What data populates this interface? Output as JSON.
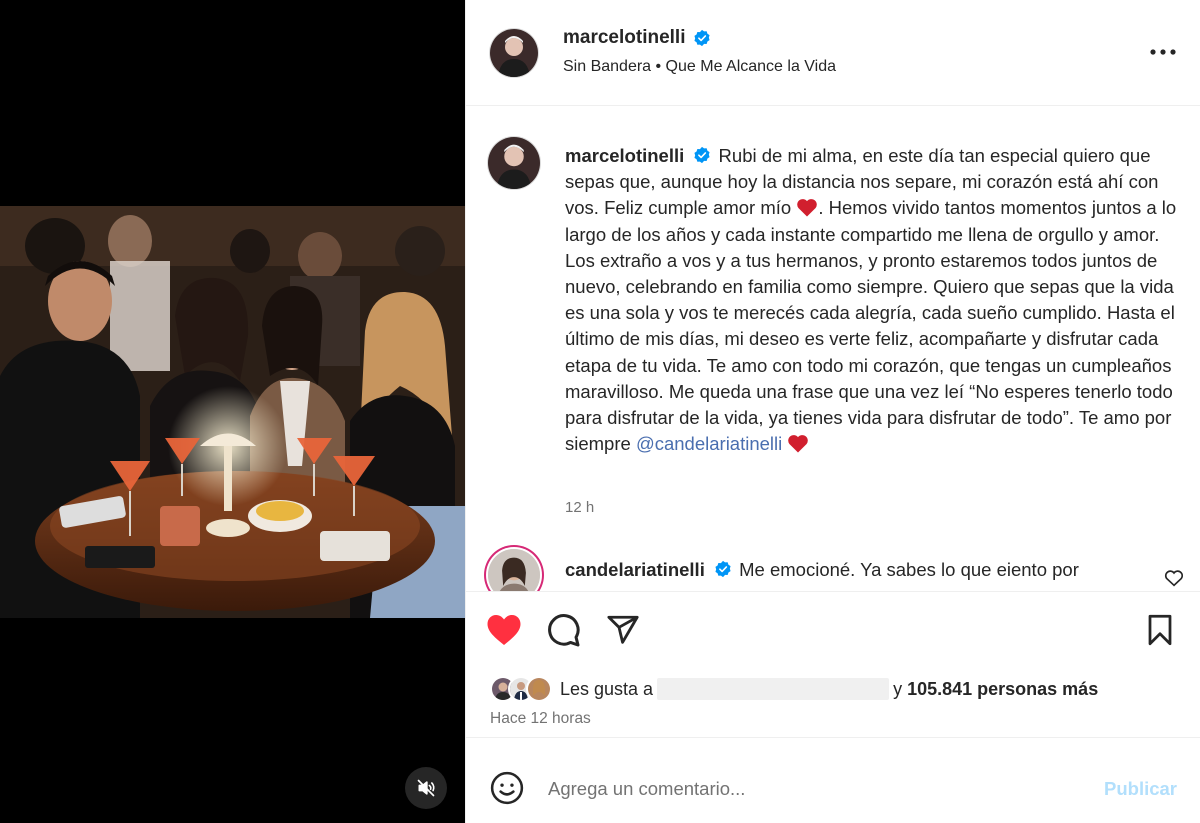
{
  "post": {
    "username": "marcelotinelli",
    "audio": "Sin Bandera • Que Me Alcance la Vida"
  },
  "caption": {
    "username": "marcelotinelli",
    "text_part1": "Rubi de mi alma, en este día tan especial quiero que sepas que, aunque hoy la distancia nos separe, mi corazón está ahí con vos. Feliz cumple amor mío ",
    "text_part2": ". Hemos vivido tantos momentos juntos a lo largo de los años y cada instante compartido me llena de orgullo y amor. Los extraño a vos y a tus hermanos, y pronto estaremos todos juntos de nuevo, celebrando en familia como siempre. Quiero que sepas que la vida es una sola y vos te merecés cada alegría, cada sueño cumplido. Hasta el último de mis días, mi deseo es verte feliz, acompañarte y disfrutar cada etapa de tu vida. Te amo con todo mi corazón, que tengas un cumpleaños maravilloso. Me queda una frase que una vez leí “No esperes tenerlo todo para disfrutar de la vida, ya tienes vida para disfrutar de todo”. Te amo por siempre ",
    "mention": "@candelariatinelli",
    "time": "12 h"
  },
  "reply": {
    "username": "candelariatinelli",
    "text": "Me emocioné. Ya sabes lo que eiento por"
  },
  "likes": {
    "prefix": "Les gusta a",
    "suffix_and": "y",
    "count": "105.841 personas más"
  },
  "posted_ago": "Hace 12 horas",
  "comment_box": {
    "placeholder": "Agrega un comentario...",
    "publish_label": "Publicar"
  },
  "colors": {
    "heart_red": "#ff3040",
    "verified_blue": "#0095f6",
    "publish_disabled": "#b2dffc",
    "muted_text": "#737373"
  },
  "icons": [
    "more-options-icon",
    "verified-icon",
    "like-heart-icon",
    "comment-icon",
    "share-icon",
    "bookmark-icon",
    "emoji-icon",
    "mute-icon",
    "small-heart-icon"
  ]
}
